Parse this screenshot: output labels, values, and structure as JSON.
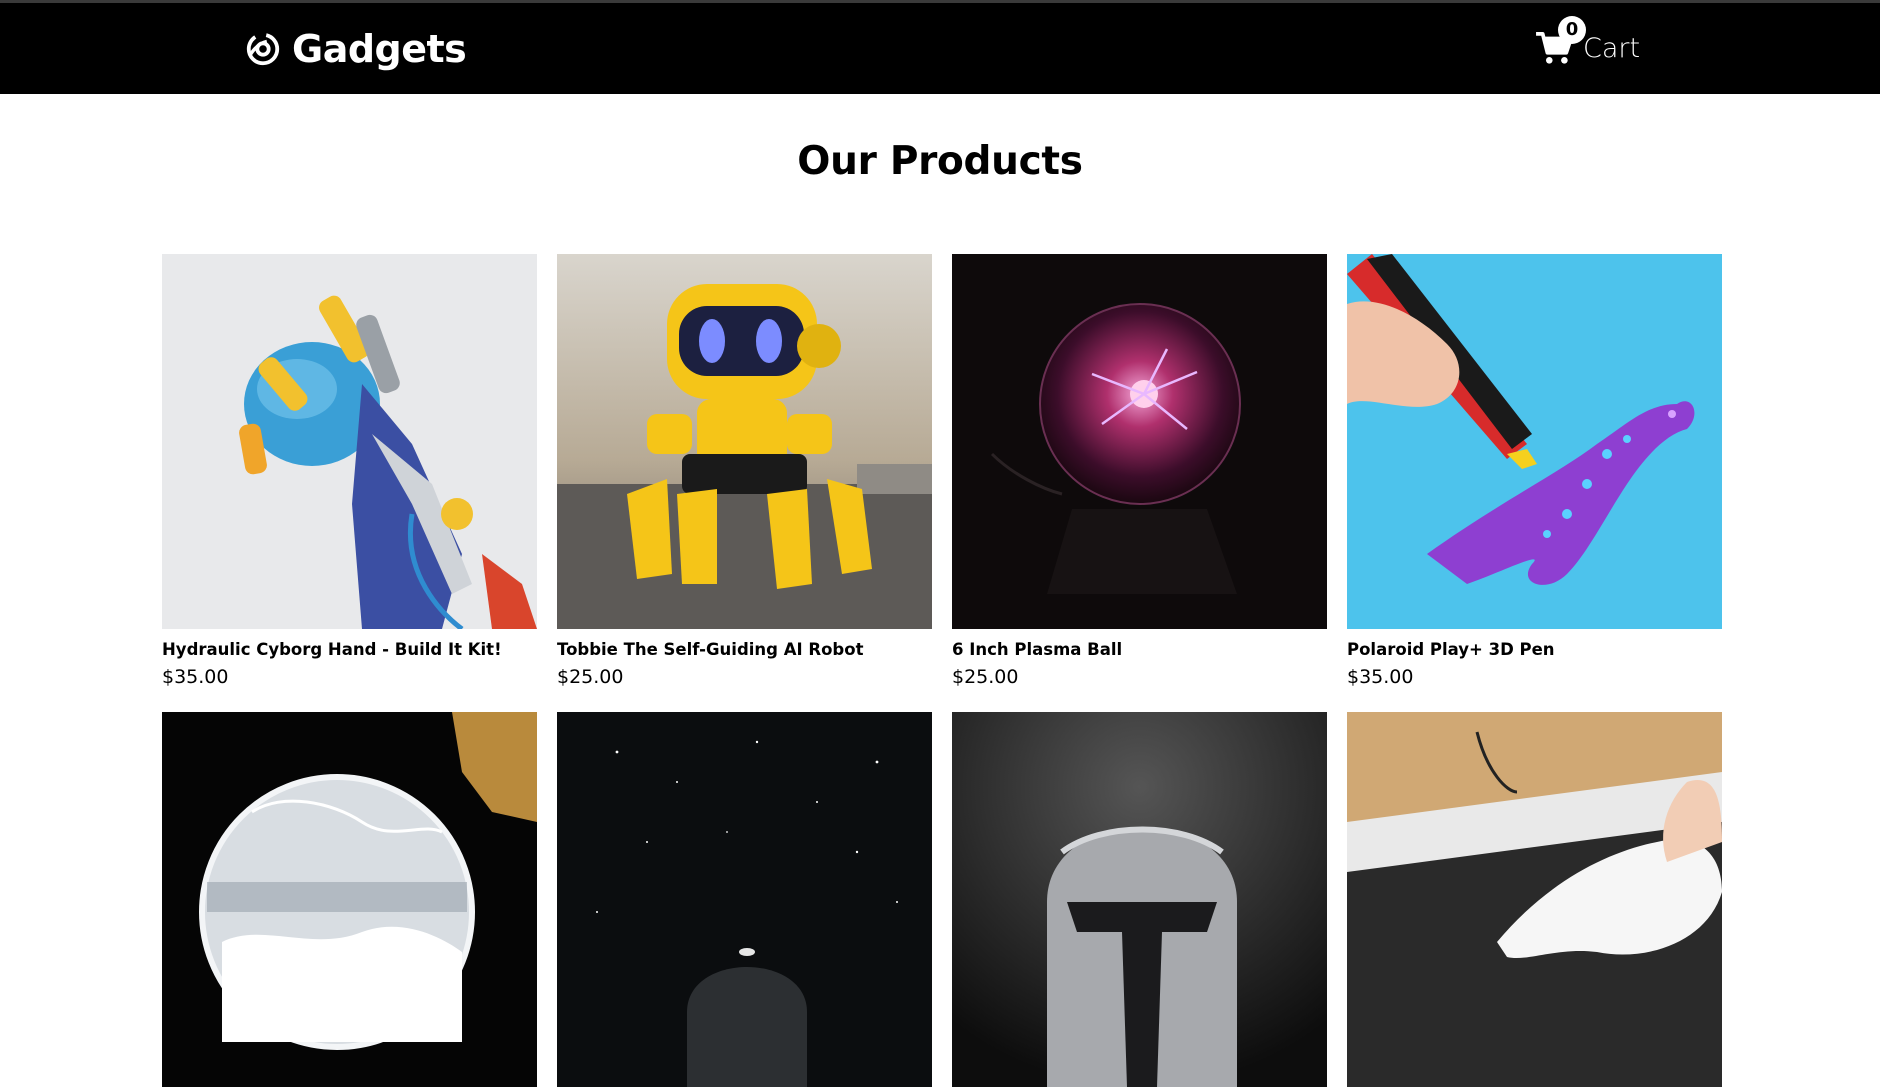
{
  "header": {
    "brand_name": "Gadgets",
    "cart_label": "Cart",
    "cart_count": "0"
  },
  "main": {
    "title": "Our Products"
  },
  "products": [
    {
      "name": "Hydraulic Cyborg Hand - Build It Kit!",
      "price": "$35.00",
      "image": "cyborg-hand-image"
    },
    {
      "name": "Tobbie The Self-Guiding AI Robot",
      "price": "$25.00",
      "image": "yellow-robot-image"
    },
    {
      "name": "6 Inch Plasma Ball",
      "price": "$25.00",
      "image": "plasma-ball-image"
    },
    {
      "name": "Polaroid Play+ 3D Pen",
      "price": "$35.00",
      "image": "3d-pen-lizard-image"
    },
    {
      "name": "",
      "price": "",
      "image": "storm-glass-globe-image"
    },
    {
      "name": "",
      "price": "",
      "image": "star-projector-image"
    },
    {
      "name": "",
      "price": "",
      "image": "mandalorian-helmet-image"
    },
    {
      "name": "",
      "price": "",
      "image": "mini-keyboard-vacuum-image"
    }
  ],
  "colors": {
    "navbar": "#000000",
    "page_background": "#ffffff",
    "text": "#000000"
  }
}
